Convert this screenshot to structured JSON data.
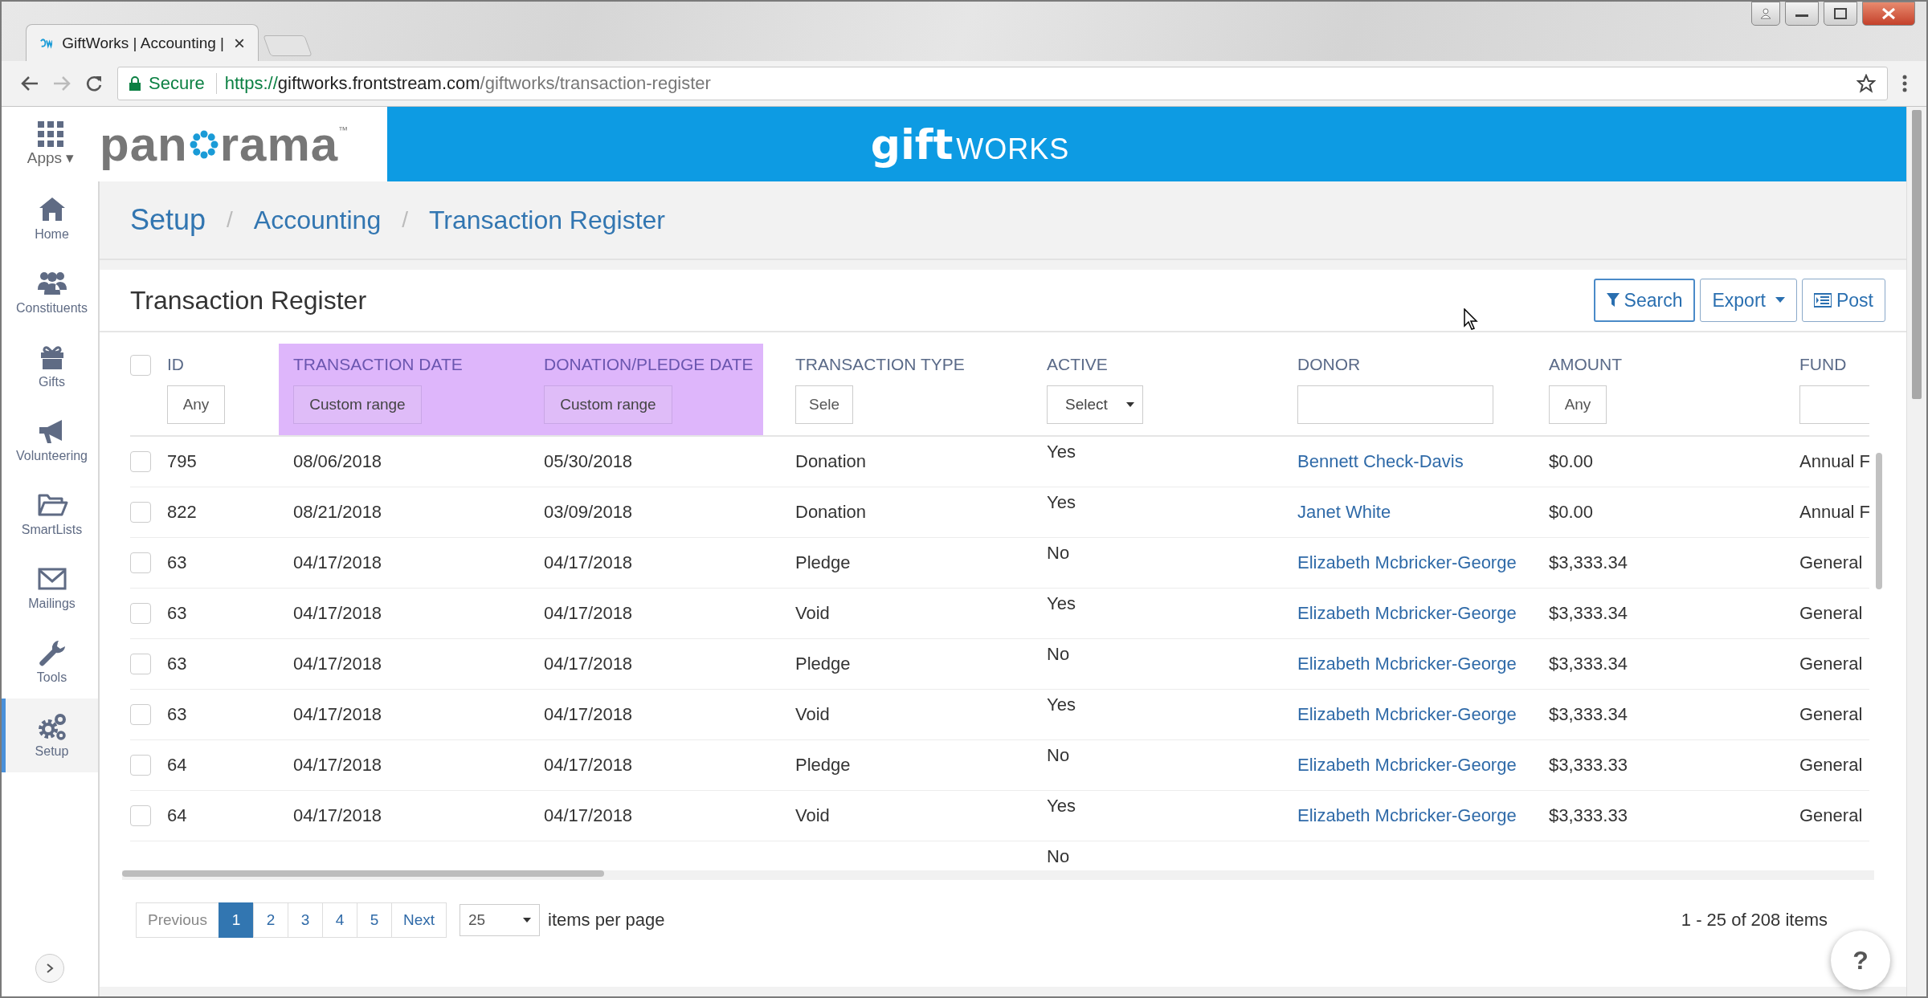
{
  "browser": {
    "tab_title": "GiftWorks | Accounting |",
    "tab_close": "×",
    "secure_label": "Secure",
    "url_scheme": "https://",
    "url_host": "giftworks.frontstream.com",
    "url_path": "/giftworks/transaction-register"
  },
  "header": {
    "apps_label": "Apps",
    "apps_caret": "▾",
    "panorama_start": "pan",
    "panorama_end": "rama",
    "panorama_mark": "™",
    "brand_bold": "gift",
    "brand_light": "WORKS"
  },
  "sidebar": {
    "items": [
      {
        "label": "Home",
        "kind": "home",
        "selected": false
      },
      {
        "label": "Constituents",
        "kind": "people",
        "selected": false
      },
      {
        "label": "Gifts",
        "kind": "gift",
        "selected": false
      },
      {
        "label": "Volunteering",
        "kind": "megaphone",
        "selected": false
      },
      {
        "label": "SmartLists",
        "kind": "folder",
        "selected": false
      },
      {
        "label": "Mailings",
        "kind": "envelope",
        "selected": false
      },
      {
        "label": "Tools",
        "kind": "wrench",
        "selected": false
      },
      {
        "label": "Setup",
        "kind": "gears",
        "selected": true
      }
    ]
  },
  "breadcrumb": [
    "Setup",
    "Accounting",
    "Transaction Register"
  ],
  "breadcrumb_separator": "/",
  "panel": {
    "title": "Transaction Register",
    "buttons": [
      {
        "label": "Search",
        "kind": "filter"
      },
      {
        "label": "Export",
        "kind": "dropdown"
      },
      {
        "label": "Post",
        "kind": "list"
      }
    ]
  },
  "table": {
    "columns": [
      {
        "label": "ID",
        "highlighted": false,
        "filter": {
          "kind": "text",
          "placeholder": "Any"
        }
      },
      {
        "label": "TRANSACTION DATE",
        "highlighted": true,
        "filter": {
          "kind": "button",
          "label": "Custom range"
        }
      },
      {
        "label": "DONATION/PLEDGE DATE",
        "highlighted": true,
        "filter": {
          "kind": "button",
          "label": "Custom range"
        }
      },
      {
        "label": "TRANSACTION TYPE",
        "highlighted": false,
        "filter": {
          "kind": "text",
          "placeholder": "Sele"
        }
      },
      {
        "label": "ACTIVE",
        "highlighted": false,
        "filter": {
          "kind": "select",
          "value": "Select"
        }
      },
      {
        "label": "DONOR",
        "highlighted": false,
        "filter": {
          "kind": "text"
        }
      },
      {
        "label": "AMOUNT",
        "highlighted": false,
        "filter": {
          "kind": "text",
          "placeholder": "Any"
        }
      },
      {
        "label": "FUND",
        "highlighted": false,
        "filter": {
          "kind": "text"
        }
      }
    ],
    "all_checked": false,
    "rows": [
      {
        "checked": false,
        "cells": [
          "795",
          "08/06/2018",
          "05/30/2018",
          "Donation",
          "Yes",
          "Bennett Check-Davis",
          "$0.00",
          "Annual F"
        ]
      },
      {
        "checked": false,
        "cells": [
          "822",
          "08/21/2018",
          "03/09/2018",
          "Donation",
          "Yes",
          "Janet White",
          "$0.00",
          "Annual F"
        ]
      },
      {
        "checked": false,
        "cells": [
          "63",
          "04/17/2018",
          "04/17/2018",
          "Pledge",
          "No",
          "Elizabeth Mcbricker-George",
          "$3,333.34",
          "General"
        ]
      },
      {
        "checked": false,
        "cells": [
          "63",
          "04/17/2018",
          "04/17/2018",
          "Void",
          "Yes",
          "Elizabeth Mcbricker-George",
          "$3,333.34",
          "General"
        ]
      },
      {
        "checked": false,
        "cells": [
          "63",
          "04/17/2018",
          "04/17/2018",
          "Pledge",
          "No",
          "Elizabeth Mcbricker-George",
          "$3,333.34",
          "General"
        ]
      },
      {
        "checked": false,
        "cells": [
          "63",
          "04/17/2018",
          "04/17/2018",
          "Void",
          "Yes",
          "Elizabeth Mcbricker-George",
          "$3,333.34",
          "General"
        ]
      },
      {
        "checked": false,
        "cells": [
          "64",
          "04/17/2018",
          "04/17/2018",
          "Pledge",
          "No",
          "Elizabeth Mcbricker-George",
          "$3,333.33",
          "General"
        ]
      },
      {
        "checked": false,
        "cells": [
          "64",
          "04/17/2018",
          "04/17/2018",
          "Void",
          "Yes",
          "Elizabeth Mcbricker-George",
          "$3,333.33",
          "General"
        ]
      }
    ],
    "partial_row": {
      "active": "No"
    }
  },
  "pagination": {
    "previous": "Previous",
    "next": "Next",
    "pages": [
      {
        "label": "1",
        "selected": true
      },
      {
        "label": "2",
        "selected": false
      },
      {
        "label": "3",
        "selected": false
      },
      {
        "label": "4",
        "selected": false
      },
      {
        "label": "5",
        "selected": false
      }
    ],
    "page_size": "25",
    "page_size_label": "items per page",
    "summary": "1 - 25 of 208 items"
  },
  "help": "?"
}
